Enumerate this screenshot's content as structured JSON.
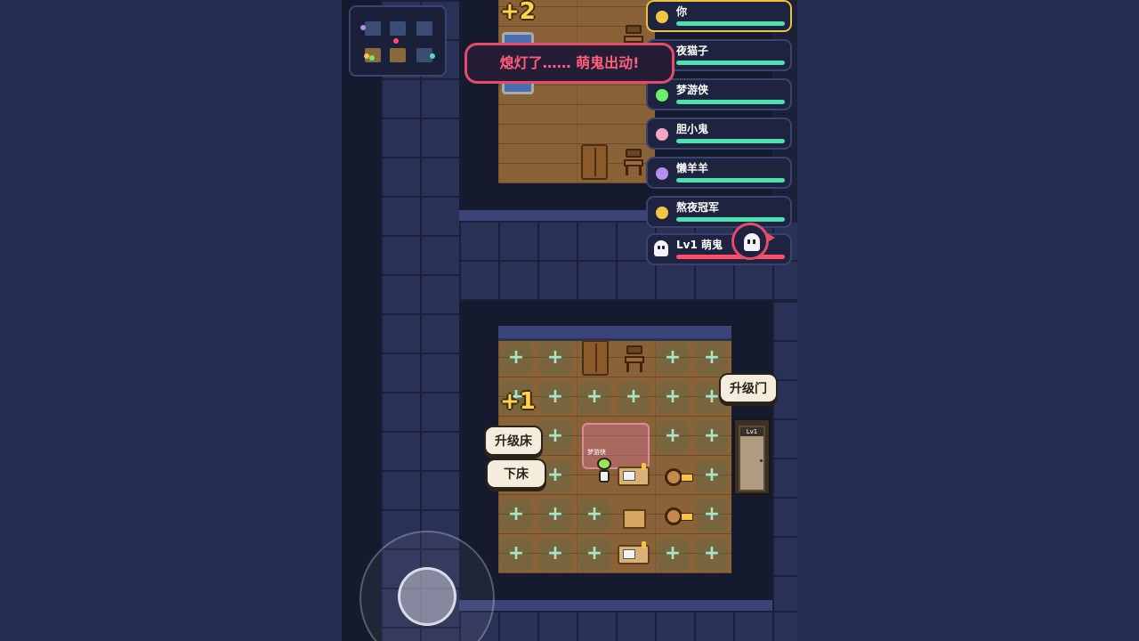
{
  "banner": {
    "text": "熄灯了…… 萌鬼出动!"
  },
  "floats": {
    "top_plus": "+2",
    "left_plus": "+1"
  },
  "buttons": {
    "upgrade_bed": "升级床",
    "get_off_bed": "下床",
    "upgrade_door": "升级门"
  },
  "door": {
    "level_tag": "Lv1"
  },
  "player_char": {
    "label": "梦游侠"
  },
  "players": [
    {
      "name": "你",
      "color": "#f5c542",
      "hp": 1.0
    },
    {
      "name": "夜猫子",
      "color": "#4de0b0",
      "hp": 1.0
    },
    {
      "name": "梦游侠",
      "color": "#6cf06c",
      "hp": 1.0
    },
    {
      "name": "胆小鬼",
      "color": "#f4a6c6",
      "hp": 1.0
    },
    {
      "name": "懒羊羊",
      "color": "#b58ef0",
      "hp": 1.0
    },
    {
      "name": "熬夜冠军",
      "color": "#f5c542",
      "hp": 1.0
    }
  ],
  "ghost": {
    "label": "Lv1 萌鬼",
    "hp": 1.0
  },
  "colors": {
    "accent_red": "#e64b6a",
    "hp_green": "#4de0b0",
    "highlight_gold": "#f0c040"
  }
}
